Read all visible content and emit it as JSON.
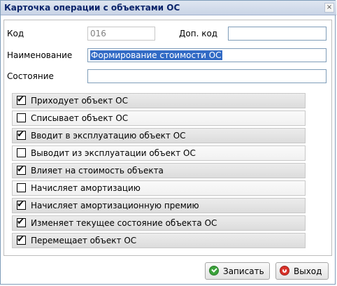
{
  "window": {
    "title": "Карточка операции с объектами ОС"
  },
  "form": {
    "code_label": "Код",
    "code_value": "016",
    "extra_code_label": "Доп. код",
    "extra_code_value": "",
    "name_label": "Наименование",
    "name_value": "Формирование стоимости ОС",
    "state_label": "Состояние",
    "state_value": ""
  },
  "options": [
    {
      "label": "Приходует объект ОС",
      "checked": true
    },
    {
      "label": "Списывает объект ОС",
      "checked": false
    },
    {
      "label": "Вводит в эксплуатацию объект ОС",
      "checked": true
    },
    {
      "label": "Выводит из эксплуатации объект ОС",
      "checked": false
    },
    {
      "label": "Влияет на стоимость объекта",
      "checked": true
    },
    {
      "label": "Начисляет амортизацию",
      "checked": false
    },
    {
      "label": "Начисляет амортизационную премию",
      "checked": true
    },
    {
      "label": "Изменяет текущее состояние объекта ОС",
      "checked": true
    },
    {
      "label": "Перемещает объект ОС",
      "checked": true
    }
  ],
  "buttons": {
    "save_label": "Записать",
    "exit_label": "Выход"
  }
}
